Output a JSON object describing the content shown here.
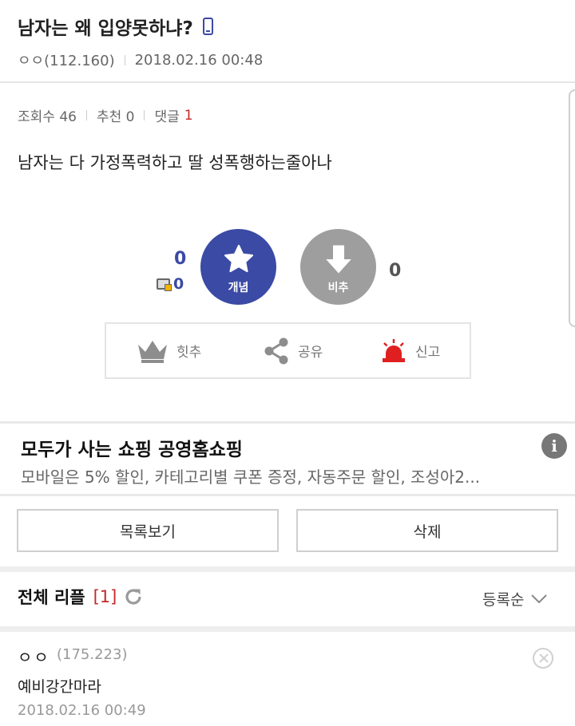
{
  "post": {
    "title": "남자는 왜 입양못하냐?",
    "author": "ㅇㅇ(112.160)",
    "datetime": "2018.02.16 00:48",
    "views_label": "조회수 46",
    "recommend_label": "추천 0",
    "comments_label": "댓글",
    "comments_count": "1",
    "body": "남자는 다 가정폭력하고 딸 성폭행하는줄아나"
  },
  "vote": {
    "up_count": "0",
    "mobile_up_count": "0",
    "up_label": "개념",
    "down_label": "비추",
    "down_count": "0"
  },
  "actions": {
    "best": "힛추",
    "share": "공유",
    "report": "신고"
  },
  "ad": {
    "title": "모두가 사는 쇼핑 공영홈쇼핑",
    "description": "모바일은 5% 할인, 카테고리별 쿠폰 증정, 자동주문 할인, 조성아2...",
    "info_icon_glyph": "i"
  },
  "buttons": {
    "list": "목록보기",
    "delete": "삭제"
  },
  "replies": {
    "title": "전체 리플",
    "count": "[1]",
    "sort_label": "등록순",
    "items": [
      {
        "author": "ㅇㅇ",
        "ip": "(175.223)",
        "text": "예비강간마라",
        "time": "2018.02.16 00:49"
      }
    ]
  },
  "colors": {
    "accent": "#3b4aa5",
    "downvote": "#9e9e9e",
    "highlight_red": "#c32a2a",
    "report_red": "#e02020"
  },
  "icons": [
    "phone-icon",
    "star-icon",
    "down-arrow-icon",
    "crown-icon",
    "share-icon",
    "siren-icon",
    "info-icon",
    "refresh-icon",
    "chevron-down-icon",
    "close-circle-icon"
  ]
}
